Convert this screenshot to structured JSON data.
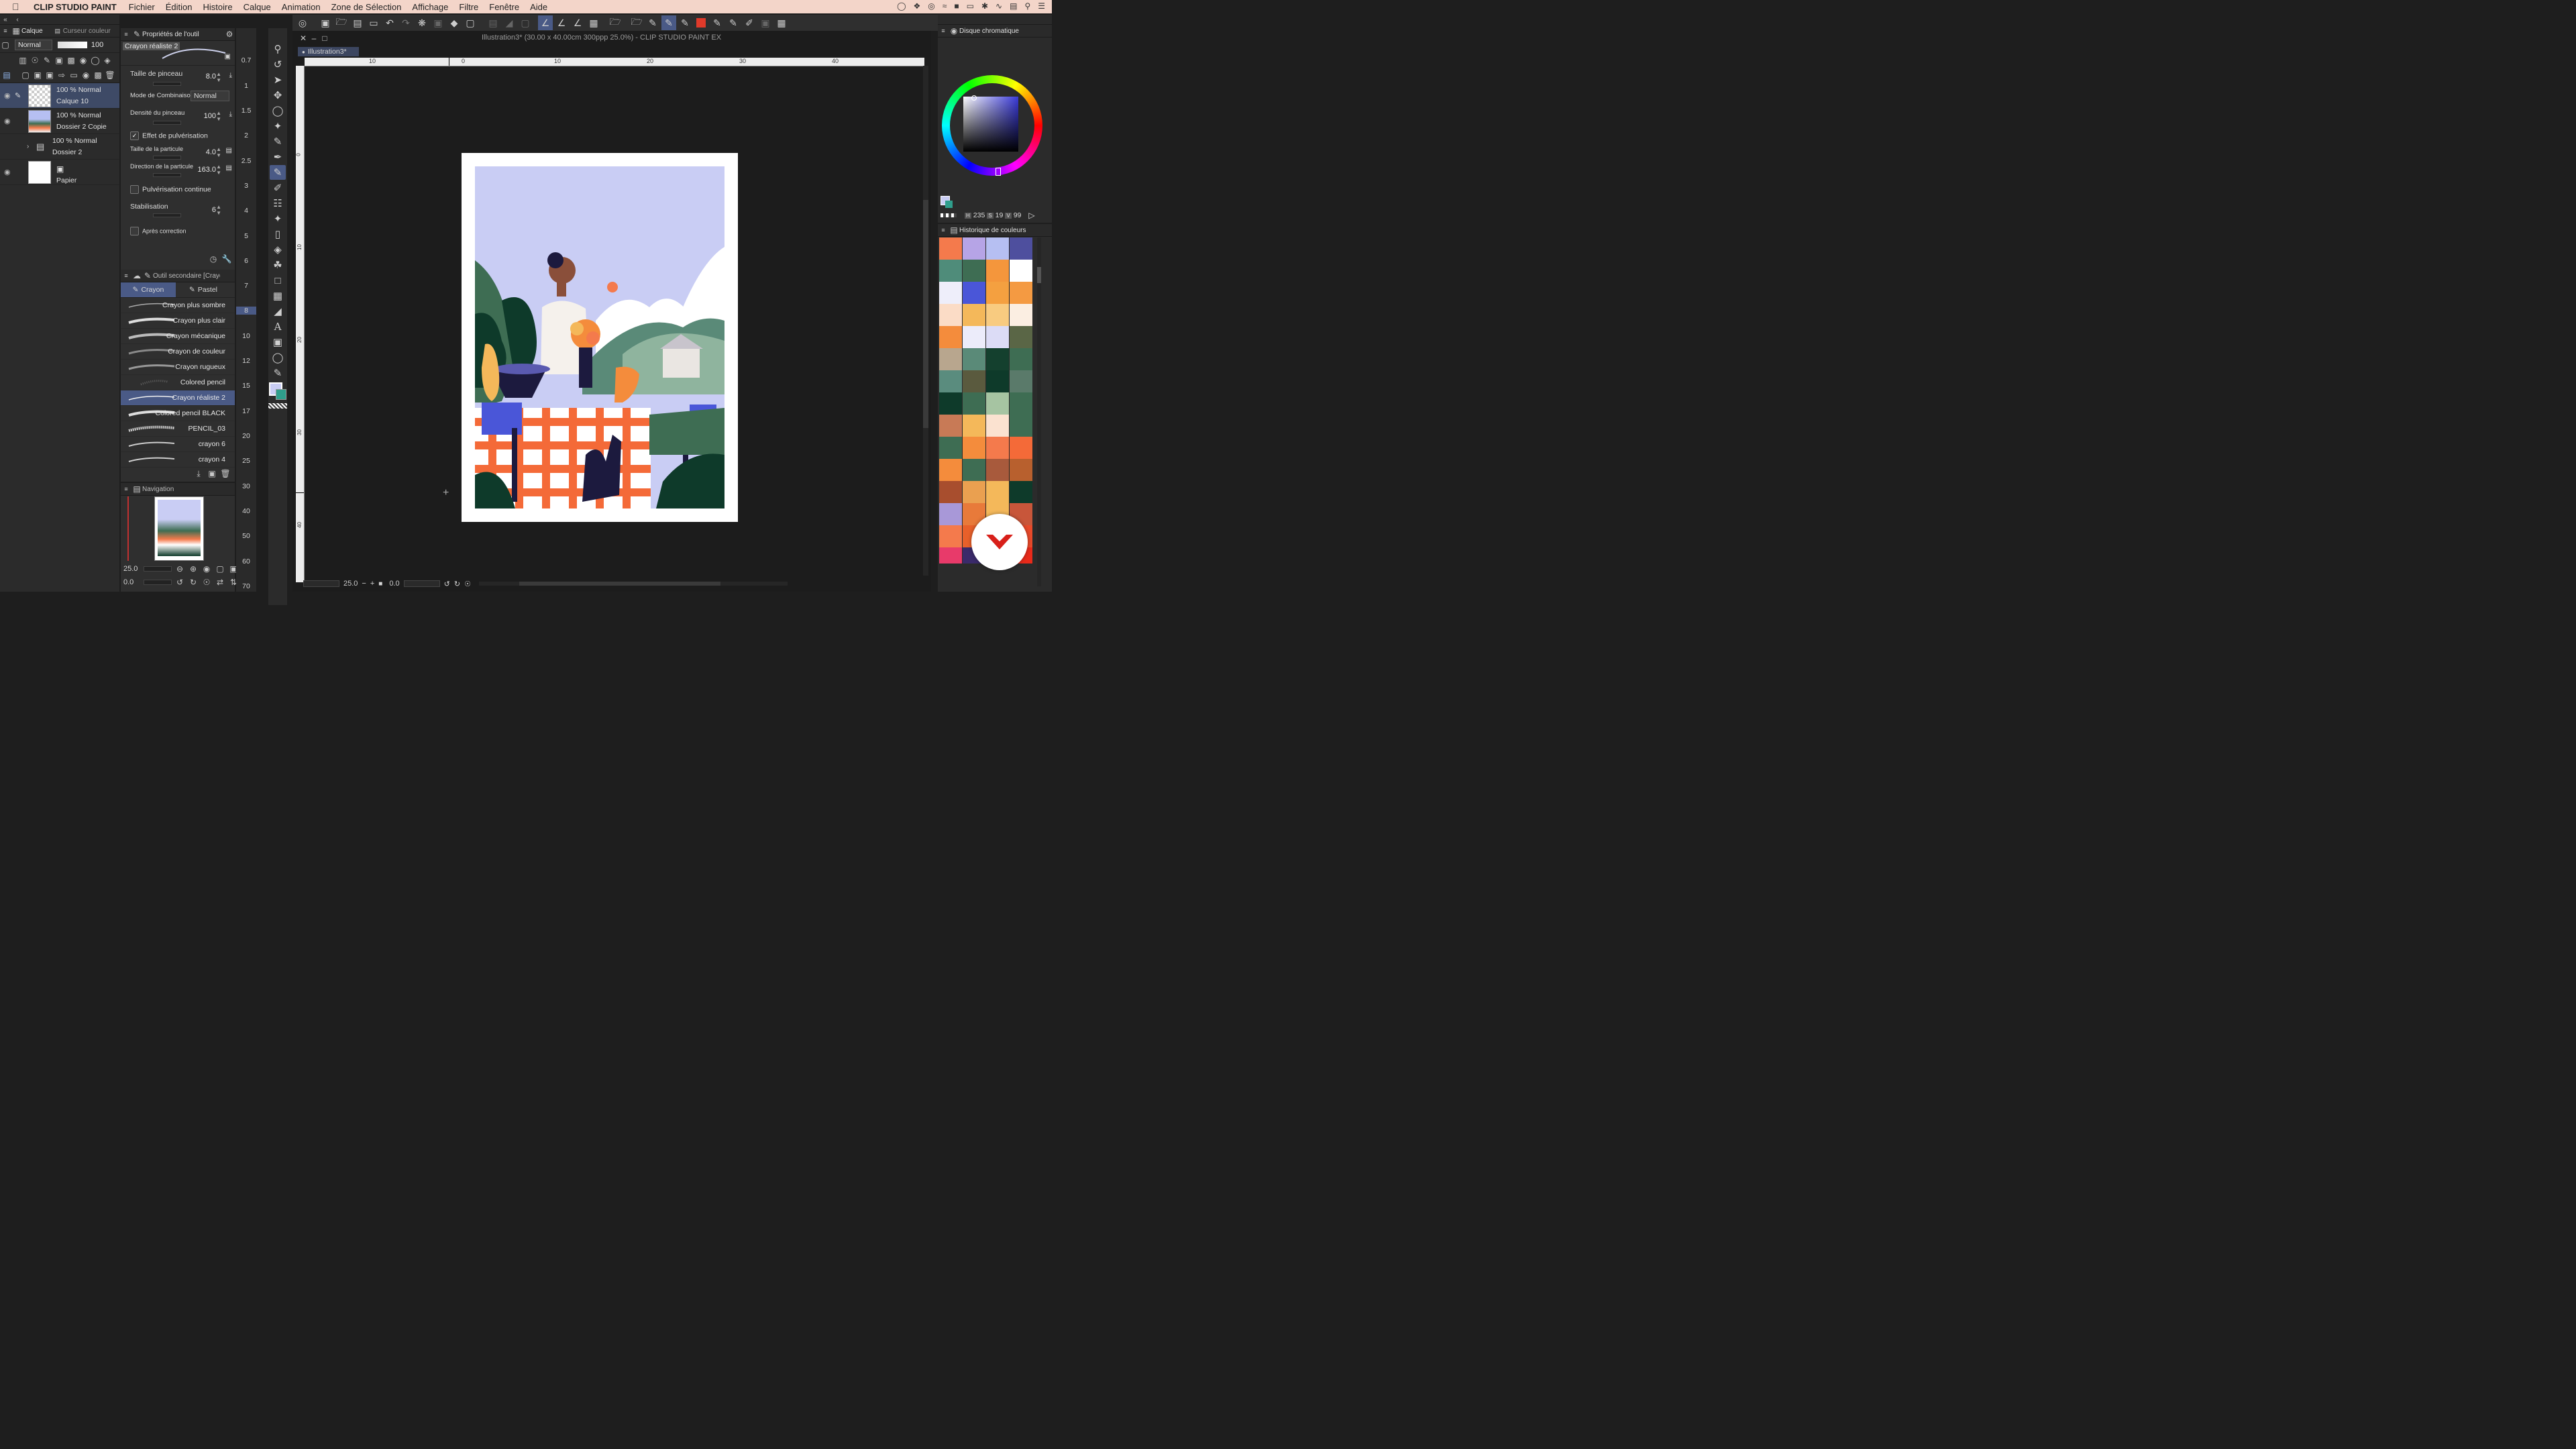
{
  "menubar": {
    "app_name": "CLIP STUDIO PAINT",
    "items": [
      "Fichier",
      "Édition",
      "Histoire",
      "Calque",
      "Animation",
      "Zone de Sélection",
      "Affichage",
      "Filtre",
      "Fenêtre",
      "Aide"
    ]
  },
  "layers_panel": {
    "tab1": "Calque",
    "tab2": "Curseur couleur",
    "blend_mode": "Normal",
    "opacity": "100",
    "layers": [
      {
        "line1": "100 % Normal",
        "line2": "Calque 10"
      },
      {
        "line1": "100 % Normal",
        "line2": "Dossier 2 Copie"
      },
      {
        "line1": "100 % Normal",
        "line2": "Dossier 2"
      },
      {
        "line1": "",
        "line2": "Papier"
      }
    ]
  },
  "tool_props": {
    "header": "Propriétés de l'outil",
    "brush_name": "Crayon réaliste 2",
    "preview_value": "0.7",
    "taille_label": "Taille de pinceau",
    "taille_value": "8.0",
    "mode_label": "Mode de Combinaison",
    "mode_value": "Normal",
    "densite_label": "Densité du pinceau",
    "densite_value": "100",
    "effet_label": "Effet de pulvérisation",
    "particule_label": "Taille de la particule",
    "particule_value": "4.0",
    "direction_label": "Direction de la particule",
    "direction_value": "163.0",
    "pulv_label": "Pulvérisation continue",
    "stab_label": "Stabilisation",
    "stab_value": "6",
    "apres_label": "Après correction"
  },
  "sub_tool": {
    "header": "Outil secondaire [Crayon]",
    "tab1": "Crayon",
    "tab2": "Pastel",
    "brushes": [
      "Crayon plus sombre",
      "Crayon plus clair",
      "Crayon mécanique",
      "Crayon de couleur",
      "Crayon rugueux",
      "Colored pencil",
      "Crayon réaliste 2",
      "Colored pencil BLACK",
      "PENCIL_03",
      "crayon 6",
      "crayon 4"
    ]
  },
  "brush_sizes": [
    "0.7",
    "1",
    "1.5",
    "2",
    "2.5",
    "3",
    "4",
    "5",
    "6",
    "7",
    "8",
    "10",
    "12",
    "15",
    "17",
    "20",
    "25",
    "30",
    "40",
    "50",
    "60",
    "70"
  ],
  "navigator": {
    "header": "Navigation",
    "zoom": "25.0",
    "rotation": "0.0"
  },
  "canvas": {
    "title": "Illustration3* (30.00 x 40.00cm 300ppp 25.0%)  - CLIP STUDIO PAINT EX",
    "tab": "Illustration3*",
    "ruler_labels": [
      "10",
      "0",
      "10",
      "20",
      "30",
      "40"
    ],
    "vruler_labels": [
      "0",
      "10",
      "20",
      "30",
      "40"
    ],
    "status_zoom": "25.0",
    "status_angle": "0.0"
  },
  "color_wheel": {
    "header": "Disque chromatique",
    "h": "235",
    "s": "19",
    "v": "99",
    "main_color": "#c9cdf4",
    "sub_color": "#2f9e8c"
  },
  "history": {
    "header": "Historique de couleurs",
    "swatches": [
      "#f47a4c",
      "#b6a4e6",
      "#b6bff2",
      "#4e4f9e",
      "#4f8c7a",
      "#3e6d53",
      "#f4963c",
      "#ffffff",
      "#eeeefa",
      "#4a56d8",
      "#f4a040",
      "#f49a42",
      "#fbdcc6",
      "#f4b85a",
      "#f8cb80",
      "#fbeee2",
      "#f48c3c",
      "#ececfa",
      "#dcdcf6",
      "#5a6646",
      "#b8a68e",
      "#5a8a78",
      "#14402e",
      "#3e6d53",
      "#5a8c7e",
      "#5a5a3e",
      "#0e3a2a",
      "#5a7a6a",
      "#0e3a2a",
      "#3e6d53",
      "#a6c4a2",
      "#3e6d53",
      "#c87a56",
      "#f4b85a",
      "#fbe2d0",
      "#3e6d53",
      "#3e6d53",
      "#f48c3c",
      "#f47a4c",
      "#f46a38",
      "#f48c3c",
      "#3e6d53",
      "#a85a3c",
      "#b8602e",
      "#a84e2e",
      "#eaa050",
      "#f4b85a",
      "#0e3a2a",
      "#a898d8",
      "#e87a3a",
      "#f4b85a",
      "#c8563a",
      "#f47a4c",
      "#e8602a",
      "#5a5aa0",
      "#e84a2a"
    ],
    "bottom_row": [
      "#e83a6a",
      "#3a2a6a",
      "#5aa0e8",
      "#e82a1a"
    ]
  }
}
